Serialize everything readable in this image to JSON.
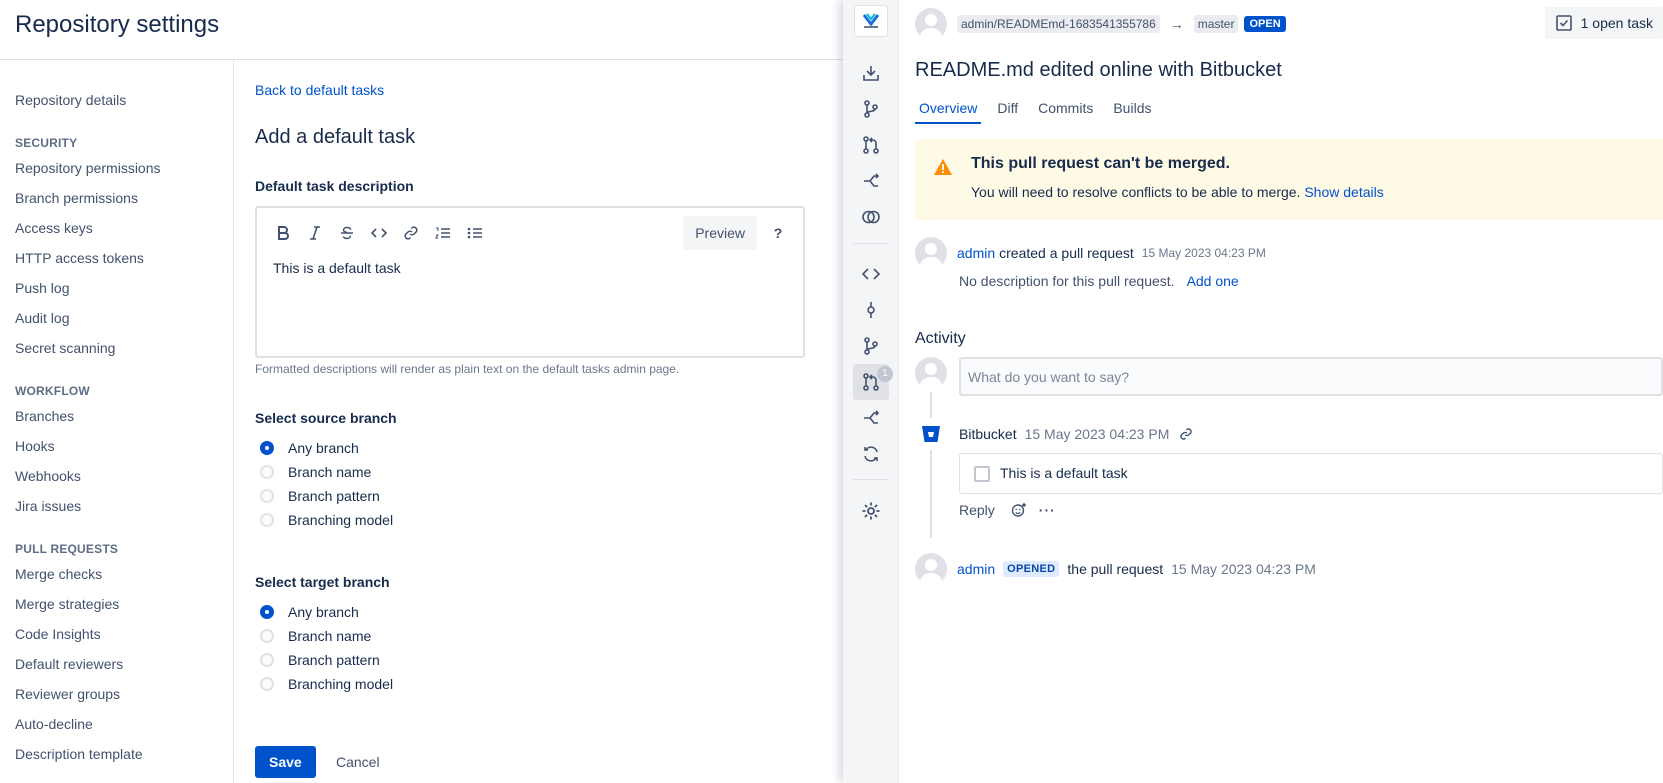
{
  "settings": {
    "title": "Repository settings",
    "nav": {
      "repository_details": "Repository details",
      "security_heading": "SECURITY",
      "security": [
        "Repository permissions",
        "Branch permissions",
        "Access keys",
        "HTTP access tokens",
        "Push log",
        "Audit log",
        "Secret scanning"
      ],
      "workflow_heading": "WORKFLOW",
      "workflow": [
        "Branches",
        "Hooks",
        "Webhooks",
        "Jira issues"
      ],
      "pull_requests_heading": "PULL REQUESTS",
      "pull_requests": [
        "Merge checks",
        "Merge strategies",
        "Code Insights",
        "Default reviewers",
        "Reviewer groups",
        "Auto-decline",
        "Description template"
      ]
    },
    "form": {
      "back_link": "Back to default tasks",
      "title": "Add a default task",
      "description_label": "Default task description",
      "preview_label": "Preview",
      "help_label": "?",
      "editor_text": "This is a default task",
      "help_text": "Formatted descriptions will render as plain text on the default tasks admin page.",
      "source_label": "Select source branch",
      "source_options": [
        "Any branch",
        "Branch name",
        "Branch pattern",
        "Branching model"
      ],
      "source_selected": 0,
      "target_label": "Select target branch",
      "target_options": [
        "Any branch",
        "Branch name",
        "Branch pattern",
        "Branching model"
      ],
      "target_selected": 0,
      "save_label": "Save",
      "cancel_label": "Cancel"
    }
  },
  "pr": {
    "repo_ref": "admin/READMEmd-1683541355786",
    "target_branch": "master",
    "status": "OPEN",
    "open_tasks": "1 open task",
    "title": "README.md edited online with Bitbucket",
    "tabs": [
      "Overview",
      "Diff",
      "Commits",
      "Builds"
    ],
    "warning": {
      "title": "This pull request can't be merged.",
      "text": "You will need to resolve conflicts to be able to merge.",
      "link": "Show details"
    },
    "created": {
      "user": "admin",
      "action": "created a pull request",
      "time": "15 May 2023 04:23 PM",
      "no_description": "No description for this pull request.",
      "add_one": "Add one"
    },
    "activity_title": "Activity",
    "comment_placeholder": "What do you want to say?",
    "bitbucket_comment": {
      "author": "Bitbucket",
      "time": "15 May 2023 04:23 PM",
      "task": "This is a default task",
      "reply": "Reply"
    },
    "opened": {
      "user": "admin",
      "badge": "OPENED",
      "action": "the pull request",
      "time": "15 May 2023 04:23 PM"
    },
    "rail_badge": "1"
  },
  "colors": {
    "accent": "#0052cc",
    "warning_bg": "#fffae6",
    "warning_icon": "#ff8b00"
  }
}
